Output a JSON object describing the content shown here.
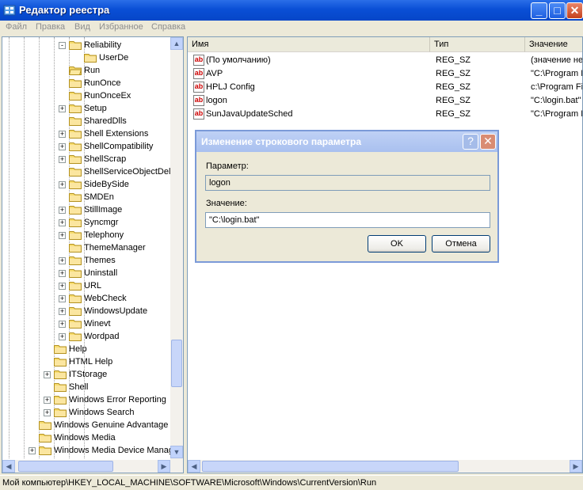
{
  "window": {
    "title": "Редактор реестра"
  },
  "menu": [
    "Файл",
    "Правка",
    "Вид",
    "Избранное",
    "Справка"
  ],
  "tree": [
    {
      "label": "Reliability",
      "level": 4,
      "expander": "-"
    },
    {
      "label": "UserDe",
      "level": 5,
      "expander": ""
    },
    {
      "label": "Run",
      "level": 4,
      "expander": "",
      "open": true
    },
    {
      "label": "RunOnce",
      "level": 4,
      "expander": ""
    },
    {
      "label": "RunOnceEx",
      "level": 4,
      "expander": ""
    },
    {
      "label": "Setup",
      "level": 4,
      "expander": "+"
    },
    {
      "label": "SharedDlls",
      "level": 4,
      "expander": ""
    },
    {
      "label": "Shell Extensions",
      "level": 4,
      "expander": "+"
    },
    {
      "label": "ShellCompatibility",
      "level": 4,
      "expander": "+"
    },
    {
      "label": "ShellScrap",
      "level": 4,
      "expander": "+"
    },
    {
      "label": "ShellServiceObjectDelayLoad",
      "level": 4,
      "expander": ""
    },
    {
      "label": "SideBySide",
      "level": 4,
      "expander": "+"
    },
    {
      "label": "SMDEn",
      "level": 4,
      "expander": ""
    },
    {
      "label": "StillImage",
      "level": 4,
      "expander": "+"
    },
    {
      "label": "Syncmgr",
      "level": 4,
      "expander": "+"
    },
    {
      "label": "Telephony",
      "level": 4,
      "expander": "+"
    },
    {
      "label": "ThemeManager",
      "level": 4,
      "expander": ""
    },
    {
      "label": "Themes",
      "level": 4,
      "expander": "+"
    },
    {
      "label": "Uninstall",
      "level": 4,
      "expander": "+"
    },
    {
      "label": "URL",
      "level": 4,
      "expander": "+"
    },
    {
      "label": "WebCheck",
      "level": 4,
      "expander": "+"
    },
    {
      "label": "WindowsUpdate",
      "level": 4,
      "expander": "+"
    },
    {
      "label": "Winevt",
      "level": 4,
      "expander": "+"
    },
    {
      "label": "Wordpad",
      "level": 4,
      "expander": "+"
    },
    {
      "label": "Help",
      "level": 3,
      "expander": ""
    },
    {
      "label": "HTML Help",
      "level": 3,
      "expander": ""
    },
    {
      "label": "ITStorage",
      "level": 3,
      "expander": "+"
    },
    {
      "label": "Shell",
      "level": 3,
      "expander": ""
    },
    {
      "label": "Windows Error Reporting",
      "level": 3,
      "expander": "+"
    },
    {
      "label": "Windows Search",
      "level": 3,
      "expander": "+"
    },
    {
      "label": "Windows Genuine Advantage",
      "level": 2,
      "expander": ""
    },
    {
      "label": "Windows Media",
      "level": 2,
      "expander": ""
    },
    {
      "label": "Windows Media Device Manager",
      "level": 2,
      "expander": "+"
    }
  ],
  "columns": {
    "name": "Имя",
    "type": "Тип",
    "data": "Значение"
  },
  "values": [
    {
      "name": "(По умолчанию)",
      "type": "REG_SZ",
      "data": "(значение не присвоено)"
    },
    {
      "name": "AVP",
      "type": "REG_SZ",
      "data": "\"C:\\Program Files\\"
    },
    {
      "name": "HPLJ Config",
      "type": "REG_SZ",
      "data": "c:\\Program Files\\"
    },
    {
      "name": "logon",
      "type": "REG_SZ",
      "data": "\"C:\\login.bat\""
    },
    {
      "name": "SunJavaUpdateSched",
      "type": "REG_SZ",
      "data": "\"C:\\Program Files\\"
    }
  ],
  "dialog": {
    "title": "Изменение строкового параметра",
    "param_label": "Параметр:",
    "param_value": "logon",
    "value_label": "Значение:",
    "value_value": "\"C:\\login.bat\"",
    "ok": "OK",
    "cancel": "Отмена",
    "help": "?",
    "close": "✕"
  },
  "status": "Мой компьютер\\HKEY_LOCAL_MACHINE\\SOFTWARE\\Microsoft\\Windows\\CurrentVersion\\Run",
  "icons": {
    "expand": "+",
    "collapse": "-",
    "up": "▲",
    "down": "▼",
    "left": "◀",
    "right": "▶",
    "minimize": "_",
    "maximize": "□",
    "close": "✕"
  }
}
